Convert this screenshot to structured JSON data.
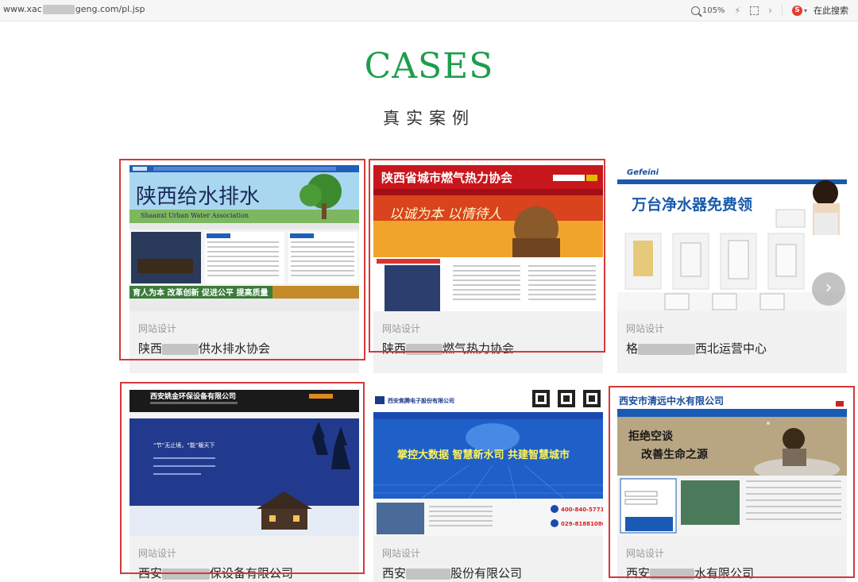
{
  "browser": {
    "url_prefix": "www.xac",
    "url_suffix": "geng.com/pl.jsp",
    "zoom": "105%",
    "search_label": "在此搜索"
  },
  "section": {
    "title": "CASES",
    "subtitle": "真实案例"
  },
  "cases": [
    {
      "category": "网站设计",
      "name_start": "陕西",
      "name_end": "供水排水协会",
      "thumb": {
        "title": "陕西给水排水",
        "eng": "Shaanxi  Urban  Water  Association",
        "slogan": "育人为本 改革创新 促进公平 提高质量"
      }
    },
    {
      "category": "网站设计",
      "name_start": "陕西",
      "name_end": "燃气热力协会",
      "thumb": {
        "title": "陕西省城市燃气热力协会",
        "slogan": "以诚为本 以情待人"
      }
    },
    {
      "category": "网站设计",
      "name_start": "格",
      "name_end": "西北运营中心",
      "thumb": {
        "title": "万台净水器免费领",
        "brand": "Gefeini"
      }
    },
    {
      "category": "网站设计",
      "name_start": "西安",
      "name_end": "保设备有限公司",
      "thumb": {
        "title": "西安姚金环保设备有限公司",
        "slogan": "“节”无止境，“能”暖天下"
      }
    },
    {
      "category": "网站设计",
      "name_start": "西安",
      "name_end": "股份有限公司",
      "thumb": {
        "title": "西安焦腾电子股份有限公司",
        "slogan": "掌控大数据 智慧新水司 共建智慧城市",
        "phone1": "400-840-5771",
        "phone2": "029-81881080"
      }
    },
    {
      "category": "网站设计",
      "name_start": "西安",
      "name_end": "水有限公司",
      "thumb": {
        "title": "西安市清远中水有限公司",
        "slogan1": "拒绝空谈",
        "slogan2": "改善生命之源"
      }
    }
  ],
  "carousel": {
    "next_icon": "chevron-right-icon",
    "next_glyph": "›"
  },
  "colors": {
    "accent": "#1e9e4d",
    "highlight": "#d33a3a",
    "card_bg": "#f1f1f1"
  }
}
